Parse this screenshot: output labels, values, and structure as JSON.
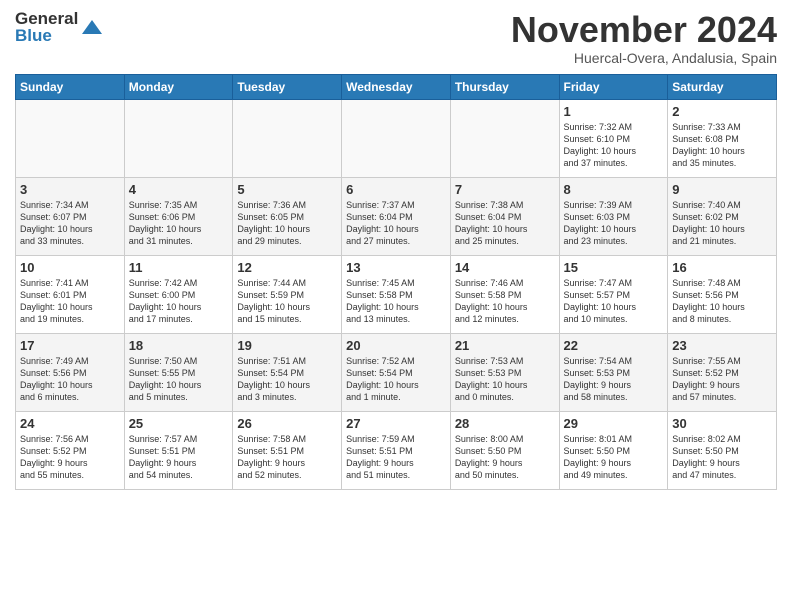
{
  "header": {
    "logo_line1": "General",
    "logo_line2": "Blue",
    "month": "November 2024",
    "location": "Huercal-Overa, Andalusia, Spain"
  },
  "weekdays": [
    "Sunday",
    "Monday",
    "Tuesday",
    "Wednesday",
    "Thursday",
    "Friday",
    "Saturday"
  ],
  "weeks": [
    [
      {
        "day": "",
        "info": ""
      },
      {
        "day": "",
        "info": ""
      },
      {
        "day": "",
        "info": ""
      },
      {
        "day": "",
        "info": ""
      },
      {
        "day": "",
        "info": ""
      },
      {
        "day": "1",
        "info": "Sunrise: 7:32 AM\nSunset: 6:10 PM\nDaylight: 10 hours\nand 37 minutes."
      },
      {
        "day": "2",
        "info": "Sunrise: 7:33 AM\nSunset: 6:08 PM\nDaylight: 10 hours\nand 35 minutes."
      }
    ],
    [
      {
        "day": "3",
        "info": "Sunrise: 7:34 AM\nSunset: 6:07 PM\nDaylight: 10 hours\nand 33 minutes."
      },
      {
        "day": "4",
        "info": "Sunrise: 7:35 AM\nSunset: 6:06 PM\nDaylight: 10 hours\nand 31 minutes."
      },
      {
        "day": "5",
        "info": "Sunrise: 7:36 AM\nSunset: 6:05 PM\nDaylight: 10 hours\nand 29 minutes."
      },
      {
        "day": "6",
        "info": "Sunrise: 7:37 AM\nSunset: 6:04 PM\nDaylight: 10 hours\nand 27 minutes."
      },
      {
        "day": "7",
        "info": "Sunrise: 7:38 AM\nSunset: 6:04 PM\nDaylight: 10 hours\nand 25 minutes."
      },
      {
        "day": "8",
        "info": "Sunrise: 7:39 AM\nSunset: 6:03 PM\nDaylight: 10 hours\nand 23 minutes."
      },
      {
        "day": "9",
        "info": "Sunrise: 7:40 AM\nSunset: 6:02 PM\nDaylight: 10 hours\nand 21 minutes."
      }
    ],
    [
      {
        "day": "10",
        "info": "Sunrise: 7:41 AM\nSunset: 6:01 PM\nDaylight: 10 hours\nand 19 minutes."
      },
      {
        "day": "11",
        "info": "Sunrise: 7:42 AM\nSunset: 6:00 PM\nDaylight: 10 hours\nand 17 minutes."
      },
      {
        "day": "12",
        "info": "Sunrise: 7:44 AM\nSunset: 5:59 PM\nDaylight: 10 hours\nand 15 minutes."
      },
      {
        "day": "13",
        "info": "Sunrise: 7:45 AM\nSunset: 5:58 PM\nDaylight: 10 hours\nand 13 minutes."
      },
      {
        "day": "14",
        "info": "Sunrise: 7:46 AM\nSunset: 5:58 PM\nDaylight: 10 hours\nand 12 minutes."
      },
      {
        "day": "15",
        "info": "Sunrise: 7:47 AM\nSunset: 5:57 PM\nDaylight: 10 hours\nand 10 minutes."
      },
      {
        "day": "16",
        "info": "Sunrise: 7:48 AM\nSunset: 5:56 PM\nDaylight: 10 hours\nand 8 minutes."
      }
    ],
    [
      {
        "day": "17",
        "info": "Sunrise: 7:49 AM\nSunset: 5:56 PM\nDaylight: 10 hours\nand 6 minutes."
      },
      {
        "day": "18",
        "info": "Sunrise: 7:50 AM\nSunset: 5:55 PM\nDaylight: 10 hours\nand 5 minutes."
      },
      {
        "day": "19",
        "info": "Sunrise: 7:51 AM\nSunset: 5:54 PM\nDaylight: 10 hours\nand 3 minutes."
      },
      {
        "day": "20",
        "info": "Sunrise: 7:52 AM\nSunset: 5:54 PM\nDaylight: 10 hours\nand 1 minute."
      },
      {
        "day": "21",
        "info": "Sunrise: 7:53 AM\nSunset: 5:53 PM\nDaylight: 10 hours\nand 0 minutes."
      },
      {
        "day": "22",
        "info": "Sunrise: 7:54 AM\nSunset: 5:53 PM\nDaylight: 9 hours\nand 58 minutes."
      },
      {
        "day": "23",
        "info": "Sunrise: 7:55 AM\nSunset: 5:52 PM\nDaylight: 9 hours\nand 57 minutes."
      }
    ],
    [
      {
        "day": "24",
        "info": "Sunrise: 7:56 AM\nSunset: 5:52 PM\nDaylight: 9 hours\nand 55 minutes."
      },
      {
        "day": "25",
        "info": "Sunrise: 7:57 AM\nSunset: 5:51 PM\nDaylight: 9 hours\nand 54 minutes."
      },
      {
        "day": "26",
        "info": "Sunrise: 7:58 AM\nSunset: 5:51 PM\nDaylight: 9 hours\nand 52 minutes."
      },
      {
        "day": "27",
        "info": "Sunrise: 7:59 AM\nSunset: 5:51 PM\nDaylight: 9 hours\nand 51 minutes."
      },
      {
        "day": "28",
        "info": "Sunrise: 8:00 AM\nSunset: 5:50 PM\nDaylight: 9 hours\nand 50 minutes."
      },
      {
        "day": "29",
        "info": "Sunrise: 8:01 AM\nSunset: 5:50 PM\nDaylight: 9 hours\nand 49 minutes."
      },
      {
        "day": "30",
        "info": "Sunrise: 8:02 AM\nSunset: 5:50 PM\nDaylight: 9 hours\nand 47 minutes."
      }
    ]
  ]
}
